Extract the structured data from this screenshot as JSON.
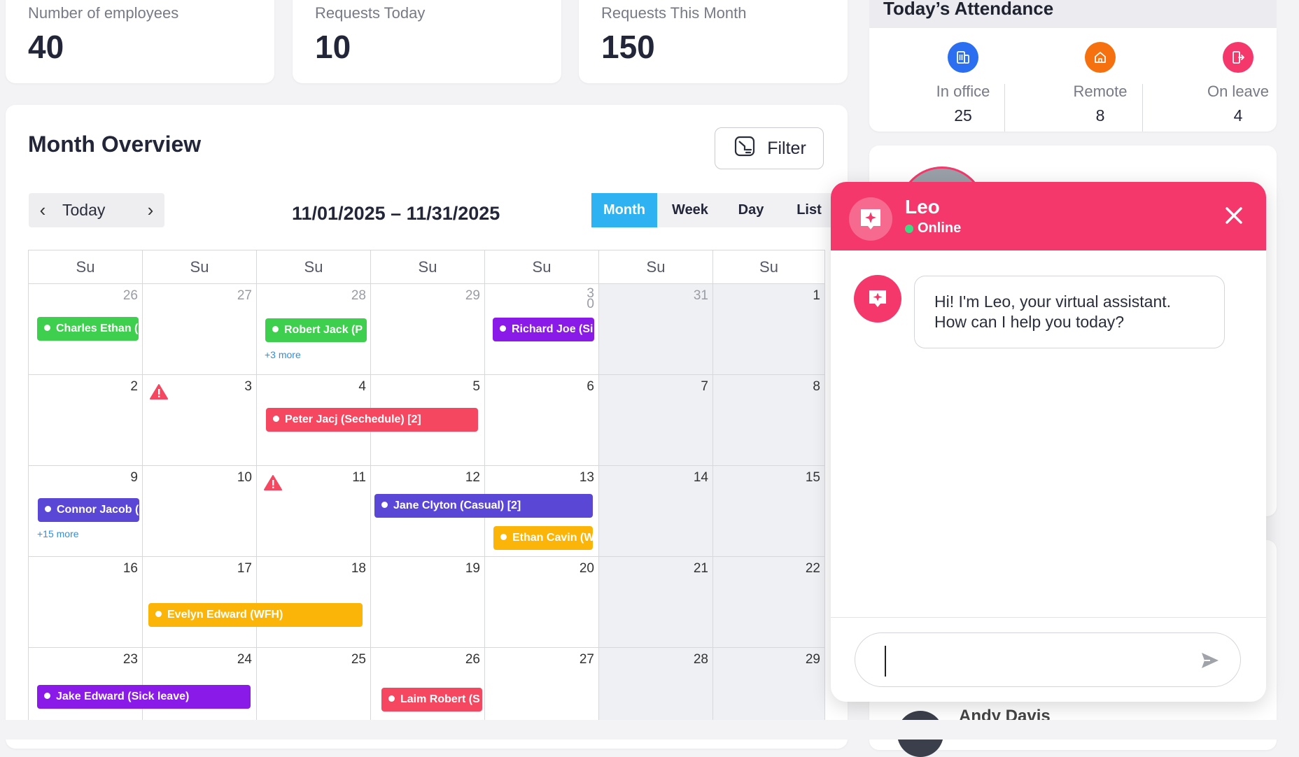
{
  "stats": [
    {
      "label": "Number of employees",
      "value": "40"
    },
    {
      "label": "Requests Today",
      "value": "10"
    },
    {
      "label": "Requests This Month",
      "value": "150"
    }
  ],
  "attendance": {
    "title": "Today’s Attendance",
    "items": [
      {
        "label": "In office",
        "count": "25",
        "icon": "building-icon",
        "color": "#2b6ff0"
      },
      {
        "label": "Remote",
        "count": "8",
        "icon": "home-icon",
        "color": "#f5700f"
      },
      {
        "label": "On leave",
        "count": "4",
        "icon": "exit-door-icon",
        "color": "#f5386b"
      }
    ]
  },
  "overview": {
    "title": "Month Overview",
    "filter_label": "Filter",
    "today_label": "Today",
    "date_range": "11/01/2025 – 11/31/2025",
    "views": [
      "Month",
      "Week",
      "Day",
      "List"
    ],
    "active_view": "Month"
  },
  "calendar": {
    "weekdays": [
      "Su",
      "Su",
      "Su",
      "Su",
      "Su",
      "Su",
      "Su"
    ],
    "weeks": [
      [
        "26",
        "27",
        "28",
        "29",
        "3\n0",
        "31",
        "1"
      ],
      [
        "2",
        "3",
        "4",
        "5",
        "6",
        "7",
        "8"
      ],
      [
        "9",
        "10",
        "11",
        "12",
        "13",
        "14",
        "15"
      ],
      [
        "16",
        "17",
        "18",
        "19",
        "20",
        "21",
        "22"
      ],
      [
        "23",
        "24",
        "25",
        "26",
        "27",
        "28",
        "29"
      ]
    ],
    "events": [
      {
        "label": "Charles Ethan (",
        "color": "#3fcf4f"
      },
      {
        "label": "Robert Jack (P",
        "color": "#3fcf4f"
      },
      {
        "label": "Richard Joe (Si",
        "color": "#8a1ae8"
      },
      {
        "label": "Peter Jacj (Sechedule) [2]",
        "color": "#f5475f"
      },
      {
        "label": "Connor Jacob (",
        "color": "#5b47d6"
      },
      {
        "label": "Jane Clyton (Casual) [2]",
        "color": "#5b47d6"
      },
      {
        "label": "Ethan Cavin (W",
        "color": "#fbb508"
      },
      {
        "label": "Evelyn Edward (WFH)",
        "color": "#fbb508"
      },
      {
        "label": "Jake Edward (Sick leave)",
        "color": "#8a1ae8"
      },
      {
        "label": "Laim Robert (S",
        "color": "#f5475f"
      }
    ],
    "more_links": [
      "+3 more",
      "+15 more"
    ]
  },
  "chat": {
    "name": "Leo",
    "status": "Online",
    "greeting_line1": "Hi! I'm Leo, your virtual assistant.",
    "greeting_line2": "How can I help you today?",
    "input_value": ""
  },
  "behind": {
    "partial_name": "Andy Davis"
  }
}
